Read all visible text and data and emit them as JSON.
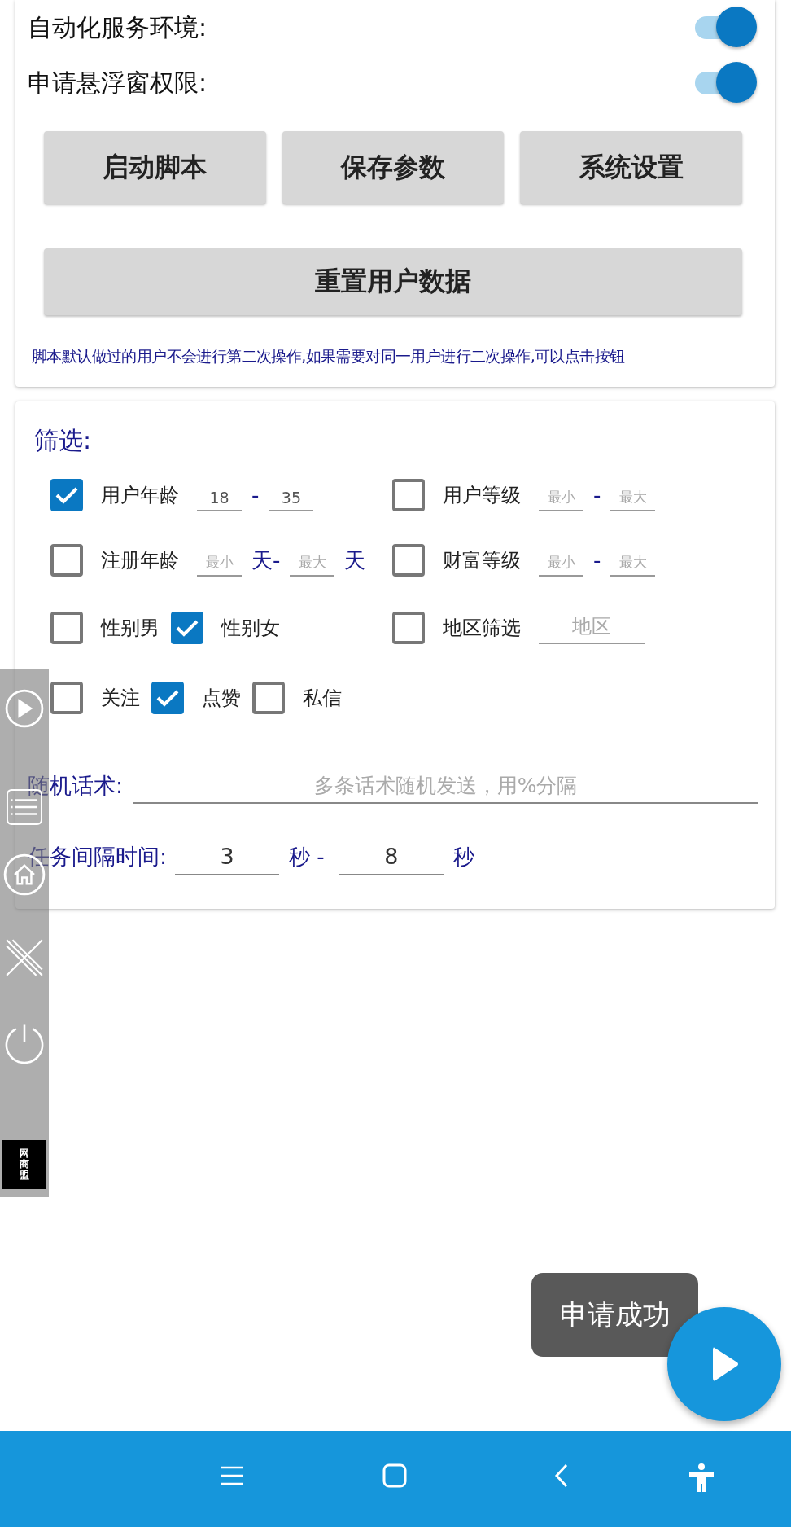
{
  "settings": {
    "toggles": [
      {
        "label": "自动化服务环境:",
        "on": true
      },
      {
        "label": "申请悬浮窗权限:",
        "on": true
      }
    ],
    "buttons": [
      "启动脚本",
      "保存参数",
      "系统设置"
    ],
    "reset_button": "重置用户数据",
    "note": "脚本默认做过的用户不会进行第二次操作,如果需要对同一用户进行二次操作,可以点击按钮"
  },
  "filter": {
    "title": "筛选:",
    "rows": [
      {
        "groups": [
          {
            "items": [
              {
                "kind": "checkbox",
                "label": "用户年龄",
                "checked": true
              },
              {
                "kind": "field",
                "value": "18"
              },
              {
                "kind": "text",
                "text": "-"
              },
              {
                "kind": "field",
                "value": "35"
              }
            ]
          },
          {
            "items": [
              {
                "kind": "checkbox",
                "label": "用户等级",
                "checked": false
              },
              {
                "kind": "field",
                "placeholder": "最小"
              },
              {
                "kind": "text",
                "text": "-"
              },
              {
                "kind": "field",
                "placeholder": "最大"
              }
            ]
          }
        ]
      },
      {
        "groups": [
          {
            "items": [
              {
                "kind": "checkbox",
                "label": "注册年龄",
                "checked": false
              },
              {
                "kind": "field",
                "placeholder": "最小"
              },
              {
                "kind": "text",
                "text": "天-"
              },
              {
                "kind": "field",
                "placeholder": "最大"
              },
              {
                "kind": "text",
                "text": "天"
              }
            ]
          },
          {
            "items": [
              {
                "kind": "checkbox",
                "label": "财富等级",
                "checked": false
              },
              {
                "kind": "field",
                "placeholder": "最小"
              },
              {
                "kind": "text",
                "text": "-"
              },
              {
                "kind": "field",
                "placeholder": "最大"
              }
            ]
          }
        ]
      },
      {
        "groups": [
          {
            "items": [
              {
                "kind": "checkbox",
                "label": "性别男",
                "checked": false
              },
              {
                "kind": "checkbox",
                "label": "性别女",
                "checked": true
              }
            ]
          },
          {
            "items": [
              {
                "kind": "checkbox",
                "label": "地区筛选",
                "checked": false
              },
              {
                "kind": "wide_field",
                "placeholder": "地区"
              }
            ]
          }
        ]
      },
      {
        "groups": [
          {
            "items": [
              {
                "kind": "checkbox",
                "label": "关注",
                "checked": false
              },
              {
                "kind": "checkbox",
                "label": "点赞",
                "checked": true
              },
              {
                "kind": "checkbox",
                "label": "私信",
                "checked": false
              }
            ]
          }
        ]
      }
    ],
    "random_talk": {
      "label": "随机话术:",
      "placeholder": "多条话术随机发送，用%分隔"
    },
    "interval": {
      "label": "任务间隔时间:",
      "min": "3",
      "unit_1": "秒 -",
      "max": "8",
      "unit_2": "秒"
    }
  },
  "floating_toolbar": {
    "logo_text": "网商盟"
  },
  "toast": "申请成功"
}
